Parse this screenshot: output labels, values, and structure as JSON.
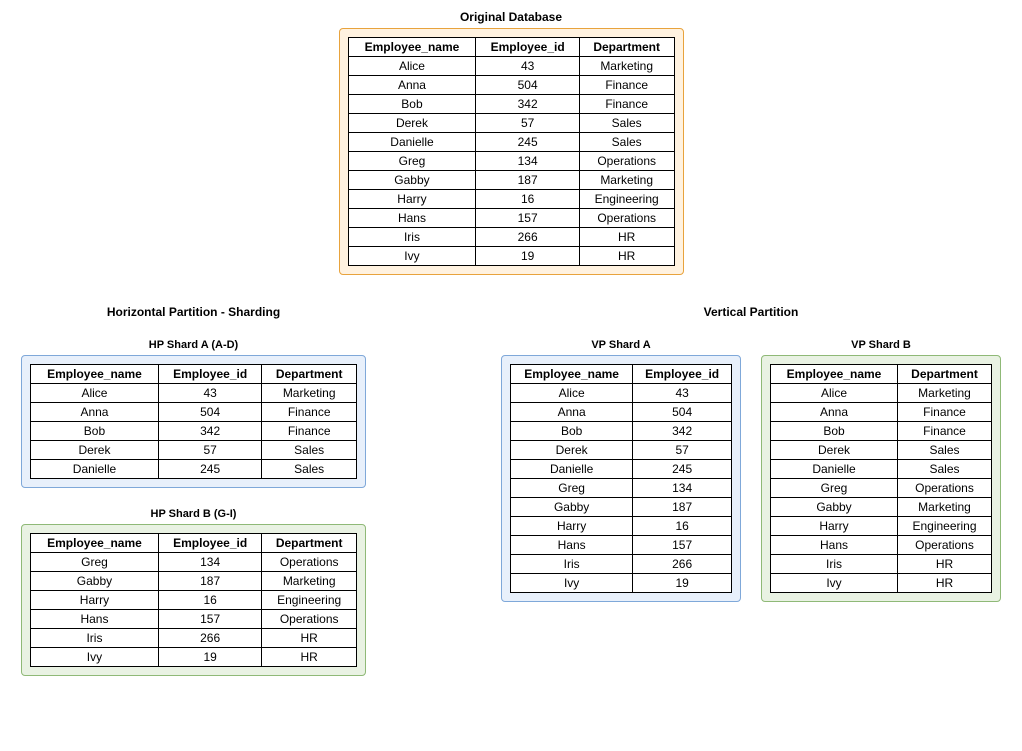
{
  "titles": {
    "original": "Original Database",
    "horizontal": "Horizontal Partition - Sharding",
    "vertical": "Vertical Partition",
    "hp_a": "HP Shard A (A-D)",
    "hp_b": "HP Shard B (G-I)",
    "vp_a": "VP Shard A",
    "vp_b": "VP Shard B"
  },
  "headers": {
    "name": "Employee_name",
    "id": "Employee_id",
    "dept": "Department"
  },
  "rows": {
    "all": [
      [
        "Alice",
        "43",
        "Marketing"
      ],
      [
        "Anna",
        "504",
        "Finance"
      ],
      [
        "Bob",
        "342",
        "Finance"
      ],
      [
        "Derek",
        "57",
        "Sales"
      ],
      [
        "Danielle",
        "245",
        "Sales"
      ],
      [
        "Greg",
        "134",
        "Operations"
      ],
      [
        "Gabby",
        "187",
        "Marketing"
      ],
      [
        "Harry",
        "16",
        "Engineering"
      ],
      [
        "Hans",
        "157",
        "Operations"
      ],
      [
        "Iris",
        "266",
        "HR"
      ],
      [
        "Ivy",
        "19",
        "HR"
      ]
    ],
    "hp_a": [
      [
        "Alice",
        "43",
        "Marketing"
      ],
      [
        "Anna",
        "504",
        "Finance"
      ],
      [
        "Bob",
        "342",
        "Finance"
      ],
      [
        "Derek",
        "57",
        "Sales"
      ],
      [
        "Danielle",
        "245",
        "Sales"
      ]
    ],
    "hp_b": [
      [
        "Greg",
        "134",
        "Operations"
      ],
      [
        "Gabby",
        "187",
        "Marketing"
      ],
      [
        "Harry",
        "16",
        "Engineering"
      ],
      [
        "Hans",
        "157",
        "Operations"
      ],
      [
        "Iris",
        "266",
        "HR"
      ],
      [
        "Ivy",
        "19",
        "HR"
      ]
    ]
  }
}
